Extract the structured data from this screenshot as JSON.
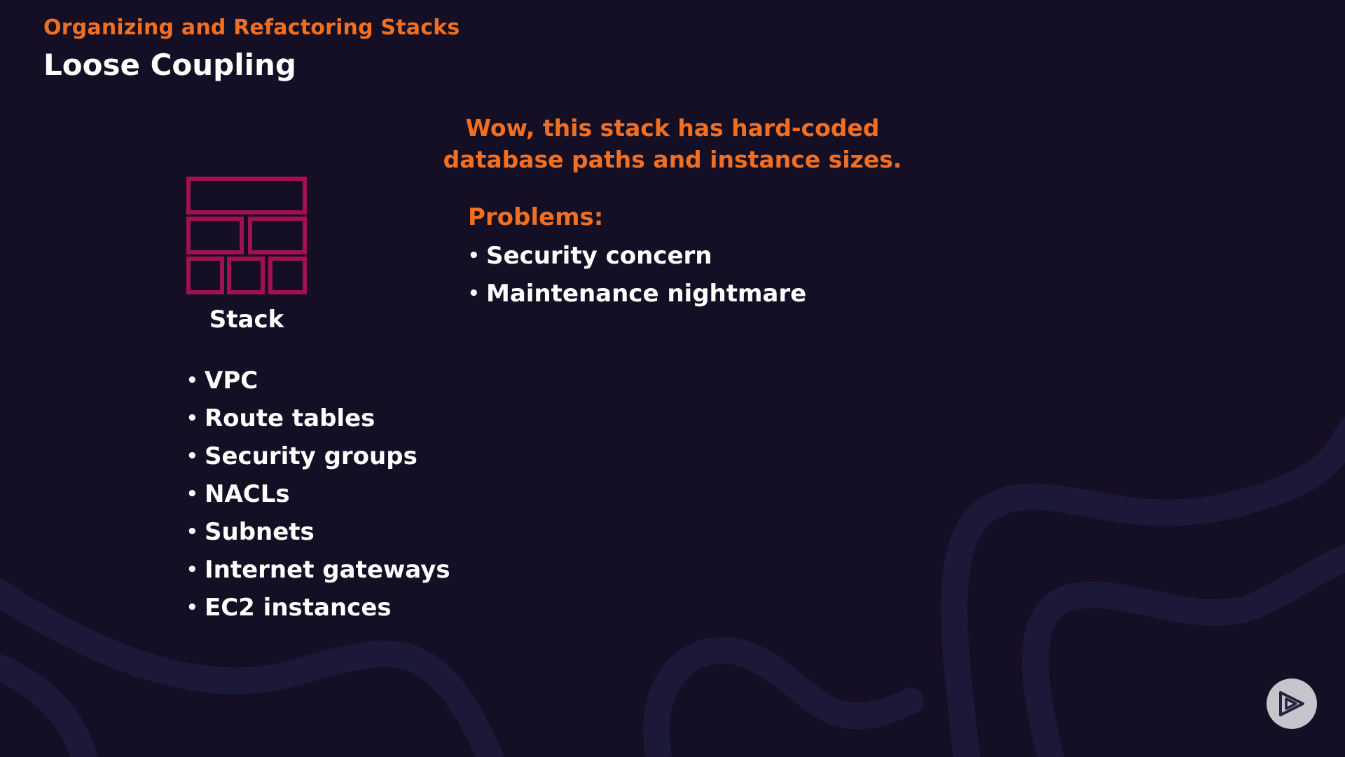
{
  "header": {
    "eyebrow": "Organizing and Refactoring Stacks",
    "title": "Loose Coupling"
  },
  "stack": {
    "icon": "stack-grid-icon",
    "label": "Stack",
    "resources": [
      "VPC",
      "Route tables",
      "Security groups",
      "NACLs",
      "Subnets",
      "Internet gateways",
      "EC2 instances"
    ]
  },
  "callout": {
    "line1": "Wow, this stack has hard-coded",
    "line2": "database paths and instance sizes."
  },
  "problems": {
    "label": "Problems:",
    "items": [
      "Security concern",
      "Maintenance nightmare"
    ]
  },
  "branding": {
    "logo_icon": "play-logo-icon"
  },
  "colors": {
    "background": "#140f24",
    "accent": "#f26f21",
    "icon": "#a3104f",
    "text": "#ffffff"
  }
}
